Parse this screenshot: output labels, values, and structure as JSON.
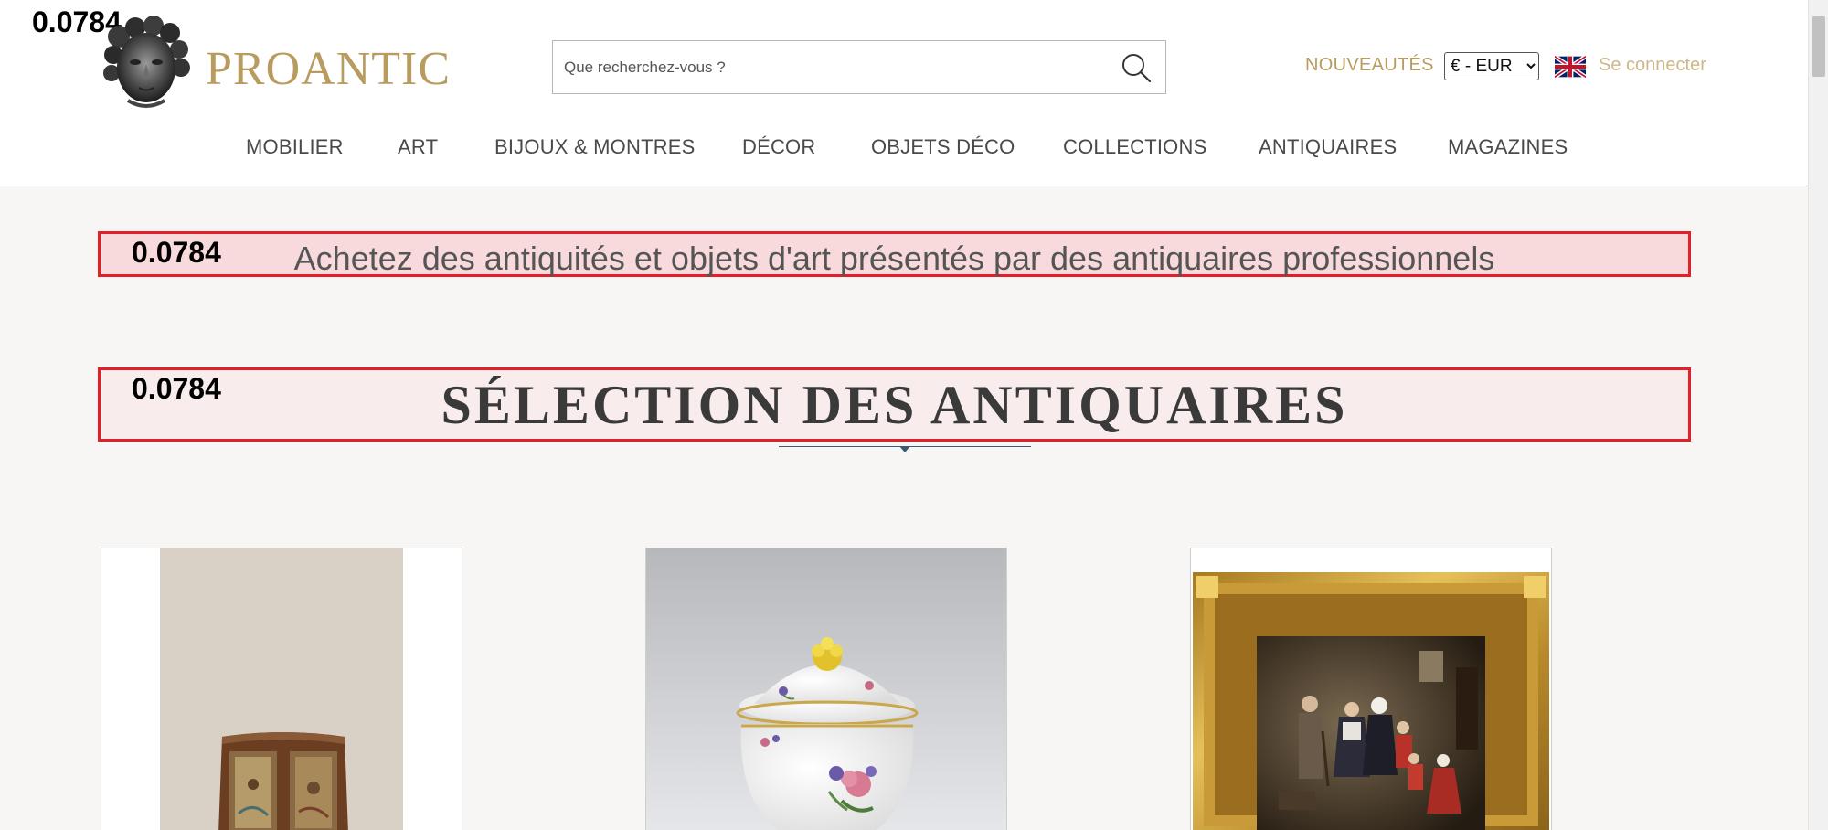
{
  "header": {
    "brand": "PROANTIC",
    "search": {
      "placeholder": "Que recherchez-vous ?"
    },
    "news_label": "NOUVEAUTÉS",
    "currency": {
      "selected": "€ - EUR"
    },
    "login_label": "Se connecter",
    "scores": [
      "0.0784",
      "0.0784",
      "0.0784"
    ]
  },
  "nav": {
    "items": [
      {
        "label": "MOBILIER"
      },
      {
        "label": "ART"
      },
      {
        "label": "BIJOUX & MONTRES"
      },
      {
        "label": "DÉCOR"
      },
      {
        "label": "OBJETS DÉCO"
      },
      {
        "label": "COLLECTIONS"
      },
      {
        "label": "ANTIQUAIRES"
      },
      {
        "label": "MAGAZINES"
      }
    ]
  },
  "main": {
    "tagline": "Achetez des antiquités et objets d'art présentés par des antiquaires professionnels",
    "section_title": "SÉLECTION DES ANTIQUAIRES"
  },
  "icons": {
    "search": "search-icon",
    "flag": "uk-flag-icon",
    "logo": "cherub-head-logo"
  },
  "colors": {
    "brand_gold": "#b89b5e",
    "highlight_red": "#e3202a",
    "divider_blue": "#3b5874"
  }
}
